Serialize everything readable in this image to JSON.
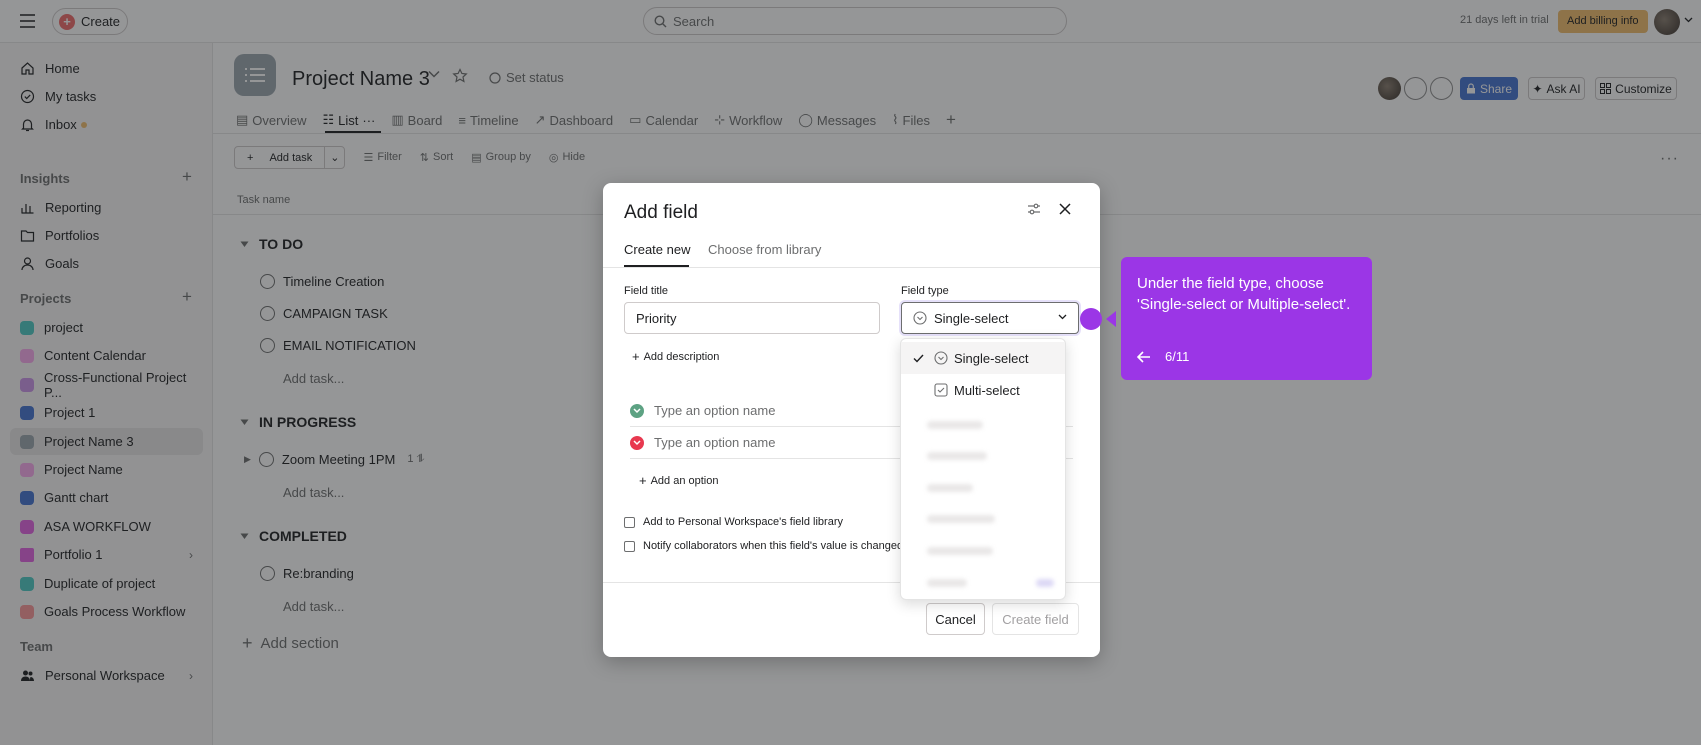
{
  "topbar": {
    "create_label": "Create",
    "search_placeholder": "Search",
    "trial_text": "21 days left in trial",
    "billing_label": "Add billing info"
  },
  "sidebar": {
    "nav": [
      {
        "label": "Home",
        "icon": "home-icon"
      },
      {
        "label": "My tasks",
        "icon": "check-circle-icon"
      },
      {
        "label": "Inbox",
        "icon": "bell-icon"
      }
    ],
    "insights_title": "Insights",
    "insights": [
      {
        "label": "Reporting",
        "icon": "chart-icon"
      },
      {
        "label": "Portfolios",
        "icon": "folder-icon"
      },
      {
        "label": "Goals",
        "icon": "person-icon"
      }
    ],
    "projects_title": "Projects",
    "projects": [
      {
        "label": "project",
        "color": "#4ecbc4"
      },
      {
        "label": "Content Calendar",
        "color": "#f9aaef"
      },
      {
        "label": "Cross-Functional Project P...",
        "color": "#cd95ea"
      },
      {
        "label": "Project 1",
        "color": "#4573d2"
      },
      {
        "label": "Project Name 3",
        "color": "#9ca6af"
      },
      {
        "label": "Project Name",
        "color": "#f9aaef"
      },
      {
        "label": "Gantt chart",
        "color": "#4573d2"
      },
      {
        "label": "ASA WORKFLOW",
        "color": "#e362e3"
      },
      {
        "label": "Portfolio 1",
        "color": "#e362e3"
      },
      {
        "label": "Duplicate of project",
        "color": "#4ecbc4"
      },
      {
        "label": "Goals Process Workflow",
        "color": "#fc979a"
      }
    ],
    "team_title": "Team",
    "team_item": "Personal Workspace"
  },
  "project": {
    "title": "Project Name 3",
    "set_status": "Set status",
    "share": "Share",
    "ask_ai": "Ask AI",
    "customize": "Customize",
    "tabs": [
      "Overview",
      "List",
      "Board",
      "Timeline",
      "Dashboard",
      "Calendar",
      "Workflow",
      "Messages",
      "Files"
    ],
    "toolbar": {
      "add_task": "Add task",
      "filter": "Filter",
      "sort": "Sort",
      "group_by": "Group by",
      "hide": "Hide"
    },
    "column_header": "Task name",
    "groups": [
      {
        "title": "TO DO",
        "tasks": [
          "Timeline Creation",
          "CAMPAIGN TASK",
          "EMAIL NOTIFICATION"
        ]
      },
      {
        "title": "IN PROGRESS",
        "tasks": [
          "Zoom Meeting 1PM"
        ],
        "subtask_count": "1"
      },
      {
        "title": "COMPLETED",
        "tasks": [
          "Re:branding"
        ]
      }
    ],
    "add_task_link": "Add task...",
    "add_section": "Add section"
  },
  "modal": {
    "title": "Add field",
    "tabs": [
      "Create new",
      "Choose from library"
    ],
    "field_title_label": "Field title",
    "field_title_value": "Priority",
    "field_type_label": "Field type",
    "field_type_value": "Single-select",
    "add_description": "Add description",
    "option_placeholder": "Type an option name",
    "option_colors": [
      "#5da283",
      "#e8384f"
    ],
    "add_option": "Add an option",
    "checkbox_library": "Add to Personal Workspace's field library",
    "checkbox_notify": "Notify collaborators when this field's value is changed",
    "cancel": "Cancel",
    "create": "Create field"
  },
  "dropdown": {
    "items": [
      "Single-select",
      "Multi-select"
    ]
  },
  "tooltip": {
    "text": "Under the field type, choose 'Single-select or Multiple-select'.",
    "step": "6/11",
    "color": "#9b36e6"
  }
}
